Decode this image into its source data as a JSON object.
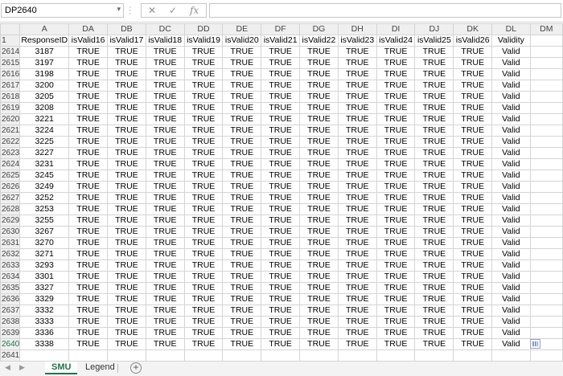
{
  "name_box": "DP2640",
  "formula_bar": {
    "cancel_icon": "✕",
    "enter_icon": "✓",
    "fx_label": "fx",
    "content": ""
  },
  "columns": [
    "A",
    "DA",
    "DB",
    "DC",
    "DD",
    "DE",
    "DF",
    "DG",
    "DH",
    "DI",
    "DJ",
    "DK",
    "DL",
    "DM"
  ],
  "header_row": {
    "row_number": "1",
    "cells": [
      "ResponseID",
      "isValid16",
      "isValid17",
      "isValid18",
      "isValid19",
      "isValid20",
      "isValid21",
      "isValid22",
      "isValid23",
      "isValid24",
      "isValid25",
      "isValid26",
      "Validity",
      ""
    ]
  },
  "rows": [
    {
      "n": "2614",
      "id": "3187"
    },
    {
      "n": "2615",
      "id": "3197"
    },
    {
      "n": "2616",
      "id": "3198"
    },
    {
      "n": "2617",
      "id": "3200"
    },
    {
      "n": "2618",
      "id": "3205"
    },
    {
      "n": "2619",
      "id": "3208"
    },
    {
      "n": "2620",
      "id": "3221"
    },
    {
      "n": "2621",
      "id": "3224"
    },
    {
      "n": "2622",
      "id": "3225"
    },
    {
      "n": "2623",
      "id": "3227"
    },
    {
      "n": "2624",
      "id": "3231"
    },
    {
      "n": "2625",
      "id": "3245"
    },
    {
      "n": "2626",
      "id": "3249"
    },
    {
      "n": "2627",
      "id": "3252"
    },
    {
      "n": "2628",
      "id": "3253"
    },
    {
      "n": "2629",
      "id": "3255"
    },
    {
      "n": "2630",
      "id": "3267"
    },
    {
      "n": "2631",
      "id": "3270"
    },
    {
      "n": "2632",
      "id": "3271"
    },
    {
      "n": "2633",
      "id": "3293"
    },
    {
      "n": "2634",
      "id": "3301"
    },
    {
      "n": "2635",
      "id": "3327"
    },
    {
      "n": "2636",
      "id": "3329"
    },
    {
      "n": "2637",
      "id": "3332"
    },
    {
      "n": "2638",
      "id": "3333"
    },
    {
      "n": "2639",
      "id": "3336"
    },
    {
      "n": "2640",
      "id": "3338"
    }
  ],
  "true_value": "TRUE",
  "validity_value": "Valid",
  "empty_row_number": "2641",
  "selected_row": "2640",
  "sheets": [
    {
      "label": "SMU",
      "active": true
    },
    {
      "label": "Legend",
      "active": false
    }
  ],
  "add_sheet_icon": "+",
  "accent_color": "#217346"
}
